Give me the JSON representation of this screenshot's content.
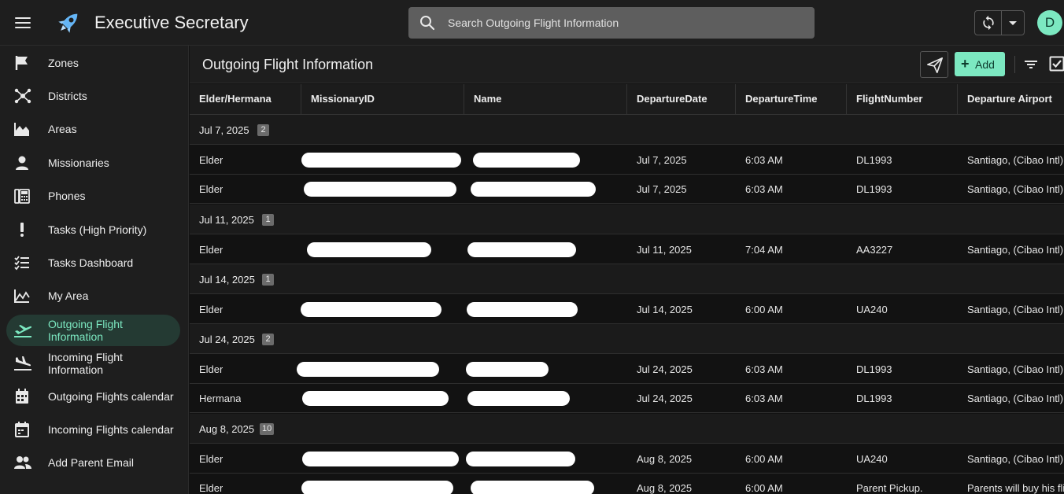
{
  "app": {
    "title": "Executive Secretary"
  },
  "search": {
    "placeholder": "Search Outgoing Flight Information"
  },
  "user": {
    "initial": "D"
  },
  "colors": {
    "accent": "#7ce8c1",
    "active_bg": "#243a33"
  },
  "sidebar": {
    "items": [
      {
        "label": "Zones",
        "icon": "flag-icon"
      },
      {
        "label": "Districts",
        "icon": "hub-icon"
      },
      {
        "label": "Areas",
        "icon": "area-chart-icon"
      },
      {
        "label": "Missionaries",
        "icon": "person-icon"
      },
      {
        "label": "Phones",
        "icon": "fax-phone-icon"
      },
      {
        "label": "Tasks (High Priority)",
        "icon": "exclamation-icon"
      },
      {
        "label": "Tasks Dashboard",
        "icon": "checklist-icon"
      },
      {
        "label": "My Area",
        "icon": "area-chart-icon"
      },
      {
        "label": "Outgoing Flight Information",
        "icon": "flight-takeoff-icon",
        "active": true
      },
      {
        "label": "Incoming Flight Information",
        "icon": "flight-land-icon"
      },
      {
        "label": "Outgoing Flights calendar",
        "icon": "calendar-icon"
      },
      {
        "label": "Incoming Flights calendar",
        "icon": "calendar-icon"
      },
      {
        "label": "Add Parent Email",
        "icon": "people-icon"
      }
    ]
  },
  "main": {
    "title": "Outgoing Flight Information",
    "add_label": "Add",
    "columns": [
      "Elder/Hermana",
      "MissionaryID",
      "Name",
      "DepartureDate",
      "DepartureTime",
      "FlightNumber",
      "Departure Airport"
    ],
    "groups": [
      {
        "label": "Jul 7, 2025",
        "count": "2",
        "rows": [
          {
            "title": "Elder",
            "date": "Jul 7, 2025",
            "time": "6:03 AM",
            "flight": "DL1993",
            "airport": "Santiago, (Cibao Intl)"
          },
          {
            "title": "Elder",
            "date": "Jul 7, 2025",
            "time": "6:03 AM",
            "flight": "DL1993",
            "airport": "Santiago, (Cibao Intl)"
          }
        ]
      },
      {
        "label": "Jul 11, 2025",
        "count": "1",
        "rows": [
          {
            "title": "Elder",
            "date": "Jul 11, 2025",
            "time": "7:04 AM",
            "flight": "AA3227",
            "airport": "Santiago, (Cibao Intl)"
          }
        ]
      },
      {
        "label": "Jul 14, 2025",
        "count": "1",
        "rows": [
          {
            "title": "Elder",
            "date": "Jul 14, 2025",
            "time": "6:00 AM",
            "flight": "UA240",
            "airport": "Santiago, (Cibao Intl)"
          }
        ]
      },
      {
        "label": "Jul 24, 2025",
        "count": "2",
        "rows": [
          {
            "title": "Elder",
            "date": "Jul 24, 2025",
            "time": "6:03 AM",
            "flight": "DL1993",
            "airport": "Santiago, (Cibao Intl)"
          },
          {
            "title": "Hermana",
            "date": "Jul 24, 2025",
            "time": "6:03 AM",
            "flight": "DL1993",
            "airport": "Santiago, (Cibao Intl)"
          }
        ]
      },
      {
        "label": "Aug 8, 2025",
        "count": "10",
        "rows": [
          {
            "title": "Elder",
            "date": "Aug 8, 2025",
            "time": "6:00 AM",
            "flight": "UA240",
            "airport": "Santiago, (Cibao Intl)"
          },
          {
            "title": "Elder",
            "date": "Aug 8, 2025",
            "time": "6:00 AM",
            "flight": "Parent Pickup.",
            "airport": "Parents will buy his flight"
          }
        ]
      }
    ]
  }
}
